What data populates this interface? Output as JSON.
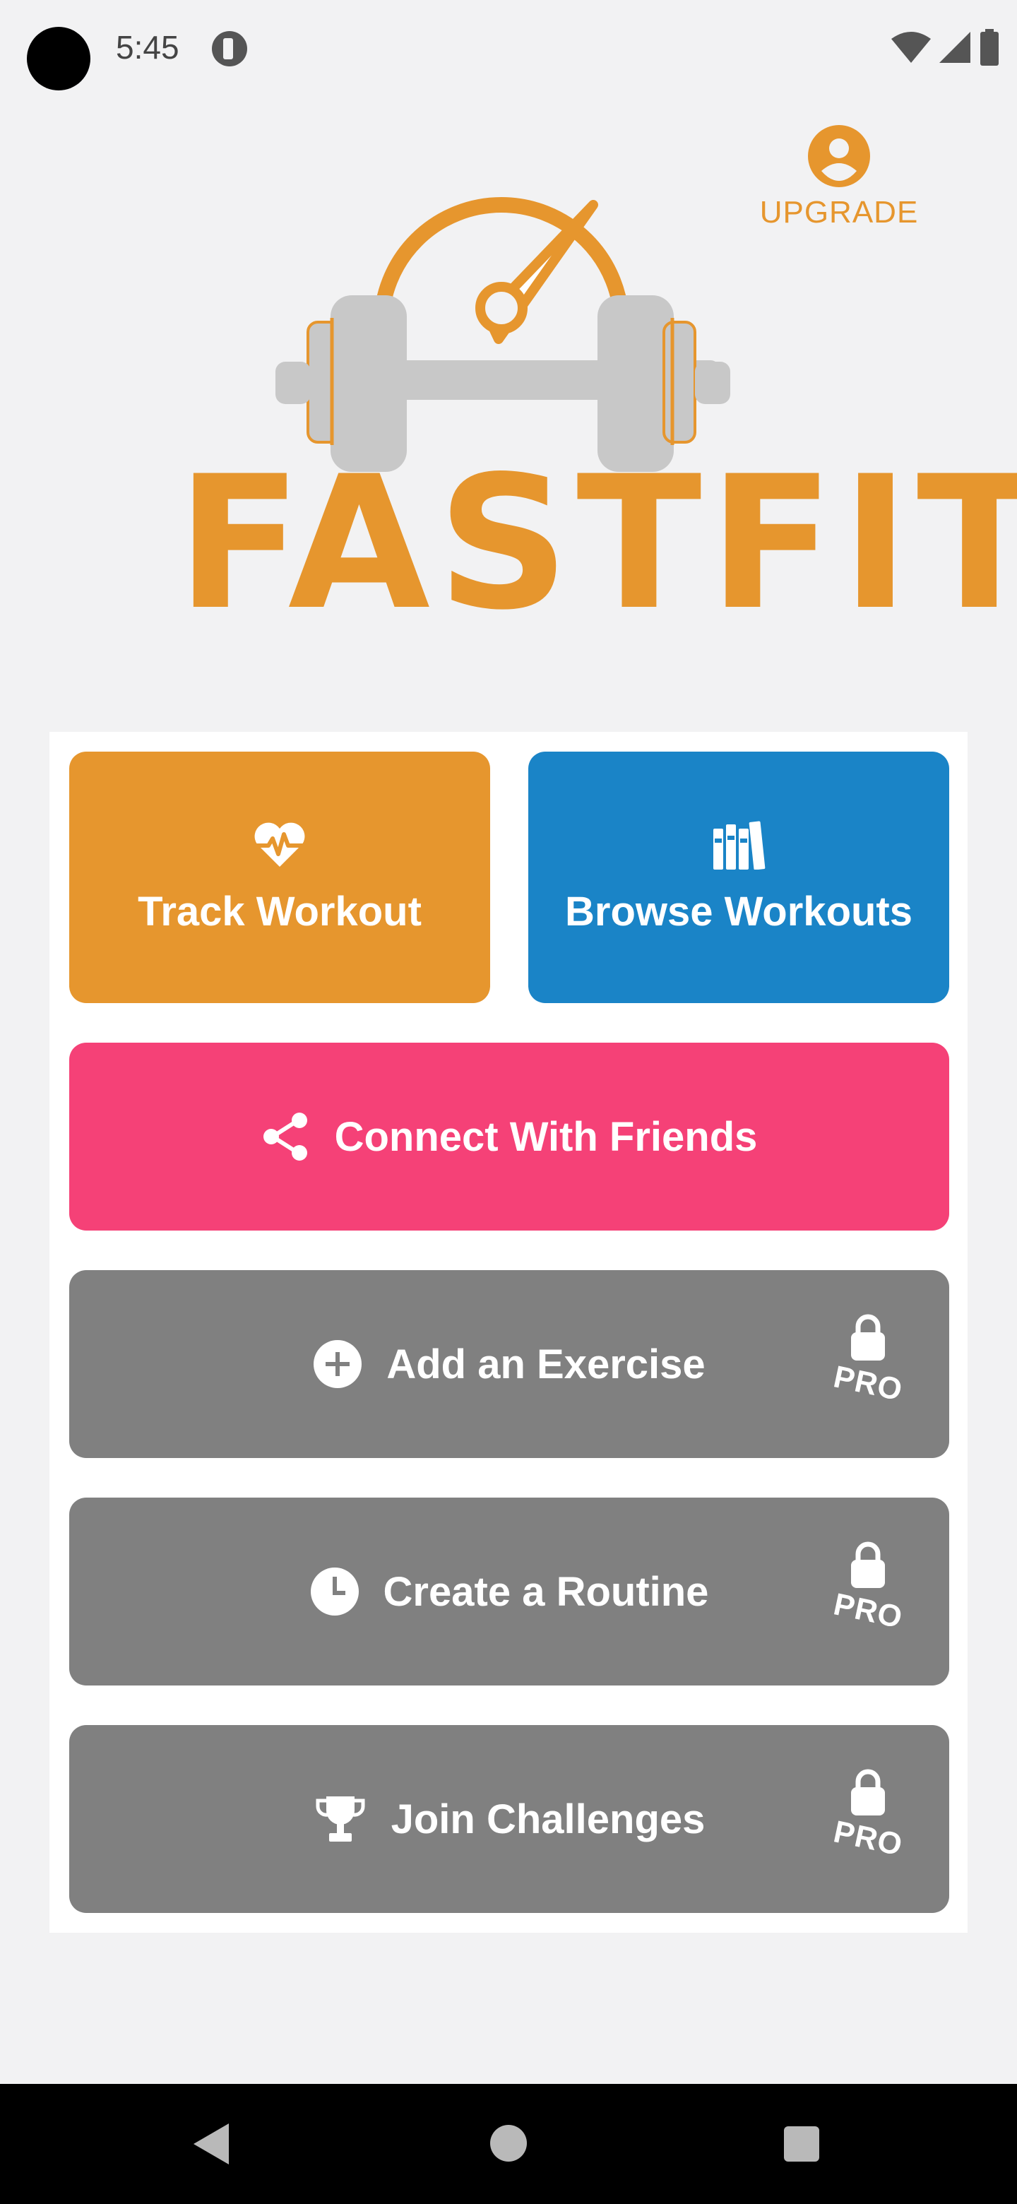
{
  "status_bar": {
    "time": "5:45"
  },
  "header": {
    "upgrade_label": "UPGRADE",
    "upgrade_icon": "account-circle-icon"
  },
  "logo": {
    "wordmark": "FASTFIT",
    "brand_color": "#e6962e",
    "graphic": "dumbbell-with-speedometer"
  },
  "menu": {
    "track_workout": {
      "label": "Track Workout",
      "icon": "heart-pulse-icon",
      "color": "#e6962e"
    },
    "browse_workouts": {
      "label": "Browse Workouts",
      "icon": "books-icon",
      "color": "#1a84c7"
    },
    "connect_friends": {
      "label": "Connect With Friends",
      "icon": "share-icon",
      "color": "#f54177"
    },
    "add_exercise": {
      "label": "Add an Exercise",
      "icon": "plus-circle-icon",
      "badge": "PRO",
      "color": "#808080"
    },
    "create_routine": {
      "label": "Create a Routine",
      "icon": "clock-icon",
      "badge": "PRO",
      "color": "#808080"
    },
    "join_challenges": {
      "label": "Join Challenges",
      "icon": "trophy-icon",
      "badge": "PRO",
      "color": "#808080"
    }
  },
  "navigation": {
    "back": "back-icon",
    "home": "home-icon",
    "recents": "recents-icon"
  }
}
